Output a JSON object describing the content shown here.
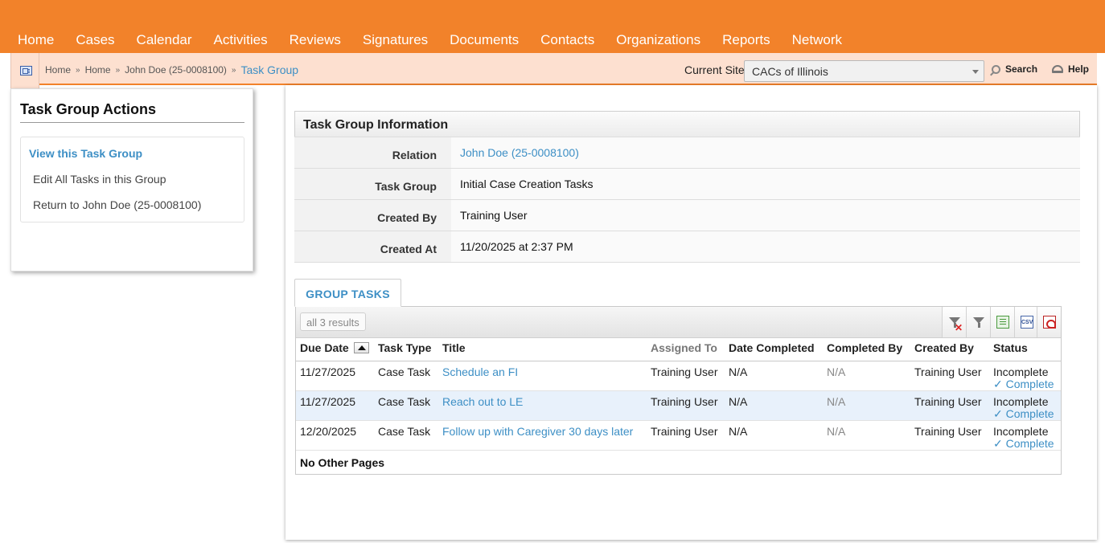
{
  "nav": {
    "items": [
      "Home",
      "Cases",
      "Calendar",
      "Activities",
      "Reviews",
      "Signatures",
      "Documents",
      "Contacts",
      "Organizations",
      "Reports",
      "Network"
    ]
  },
  "breadcrumb": {
    "items": [
      "Home",
      "Home",
      "John Doe (25-0008100)"
    ],
    "current": "Task Group"
  },
  "site": {
    "label": "Current Site",
    "selected": "CACs of Illinois"
  },
  "header_actions": {
    "search": "Search",
    "help": "Help"
  },
  "sidebar": {
    "title": "Task Group Actions",
    "links": [
      "View this Task Group",
      "Edit All Tasks in this Group",
      "Return to John Doe (25-0008100)"
    ]
  },
  "info": {
    "title": "Task Group Information",
    "rows": [
      {
        "label": "Relation",
        "value": "John Doe (25-0008100)"
      },
      {
        "label": "Task Group",
        "value": "Initial Case Creation Tasks"
      },
      {
        "label": "Created By",
        "value": "Training User"
      },
      {
        "label": "Created At",
        "value": "11/20/2025 at 2:37 PM"
      }
    ]
  },
  "tab": {
    "label": "GROUP TASKS"
  },
  "grid": {
    "results": "all 3 results",
    "csv_label": "CSV",
    "columns": [
      "Due Date",
      "Task Type",
      "Title",
      "Assigned To",
      "Date Completed",
      "Completed By",
      "Created By",
      "Status"
    ],
    "rows": [
      {
        "due": "11/27/2025",
        "type": "Case Task",
        "title": "Schedule an FI",
        "assigned": "Training User",
        "completed_date": "N/A",
        "completed_by": "N/A",
        "created_by": "Training User",
        "status": "Incomplete",
        "action": "✓ Complete"
      },
      {
        "due": "11/27/2025",
        "type": "Case Task",
        "title": "Reach out to LE",
        "assigned": "Training User",
        "completed_date": "N/A",
        "completed_by": "N/A",
        "created_by": "Training User",
        "status": "Incomplete",
        "action": "✓ Complete"
      },
      {
        "due": "12/20/2025",
        "type": "Case Task",
        "title": "Follow up with Caregiver 30 days later",
        "assigned": "Training User",
        "completed_date": "N/A",
        "completed_by": "N/A",
        "created_by": "Training User",
        "status": "Incomplete",
        "action": "✓ Complete"
      }
    ],
    "footer": "No Other Pages"
  },
  "colors": {
    "brand_orange": "#f2822a",
    "crumb_bg": "#fde0d0",
    "link_blue": "#3d8fc5"
  }
}
